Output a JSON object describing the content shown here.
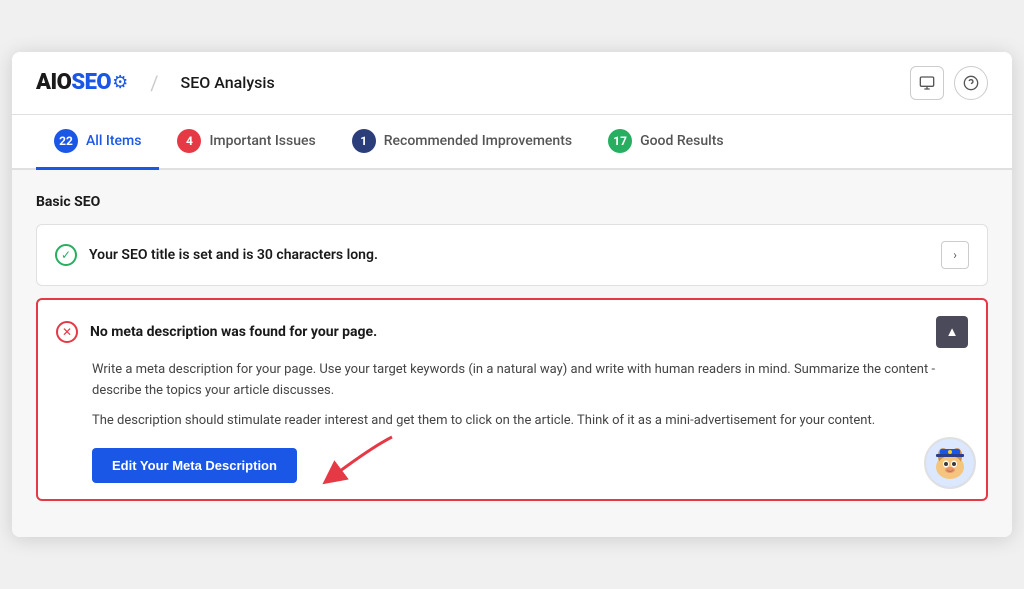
{
  "header": {
    "logo_aio": "AIO",
    "logo_seo": "SEO",
    "title": "SEO Analysis",
    "monitor_icon": "monitor-icon",
    "help_icon": "help-icon"
  },
  "tabs": [
    {
      "id": "all-items",
      "label": "All Items",
      "count": "22",
      "badge_class": "badge-blue",
      "active": true
    },
    {
      "id": "important-issues",
      "label": "Important Issues",
      "count": "4",
      "badge_class": "badge-red",
      "active": false
    },
    {
      "id": "recommended-improvements",
      "label": "Recommended Improvements",
      "count": "1",
      "badge_class": "badge-darkblue",
      "active": false
    },
    {
      "id": "good-results",
      "label": "Good Results",
      "count": "17",
      "badge_class": "badge-green",
      "active": false
    }
  ],
  "section": {
    "title": "Basic SEO"
  },
  "seo_title_card": {
    "text": "Your SEO title is set and is 30 characters long."
  },
  "meta_desc_card": {
    "title": "No meta description was found for your page.",
    "body1": "Write a meta description for your page. Use your target keywords (in a natural way) and write with human readers in mind. Summarize the content - describe the topics your article discusses.",
    "body2": "The description should stimulate reader interest and get them to click on the article. Think of it as a mini-advertisement for your content.",
    "button_label": "Edit Your Meta Description"
  }
}
